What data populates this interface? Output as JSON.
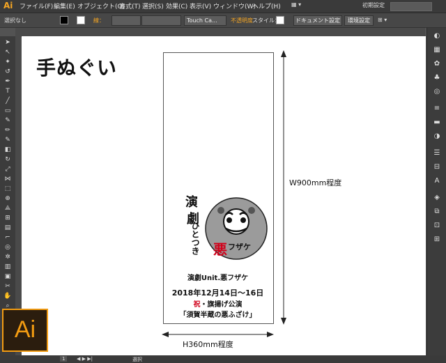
{
  "app": {
    "logo_small": "Ai",
    "logo_large": "Ai"
  },
  "menu": {
    "items": [
      "ファイル(F)",
      "編集(E)",
      "オブジェクト(O)",
      "書式(T)",
      "選択(S)",
      "効果(C)",
      "表示(V)",
      "ウィンドウ(W)",
      "ヘルプ(H)"
    ],
    "workspace": "初期設定"
  },
  "control": {
    "selection": "選択なし",
    "stroke_label": "線：",
    "touch_brush": "Touch Ca...",
    "opacity": "不透明度",
    "style": "スタイル：",
    "doc_settings": "ドキュメント設定",
    "env_settings": "環境設定"
  },
  "canvas": {
    "title": "手ぬぐい",
    "width_label": "W900mm程度",
    "height_label": "H360mm程度",
    "logo_text": "演劇Unit.悪フザケ",
    "dates": "2018年12月14日～16日",
    "celebration_prefix": "祝",
    "celebration_rest": "・旗揚げ公演",
    "show_title": "「須賀半蔵の悪ふざけ」",
    "stamp_text_red": "悪",
    "stamp_text_black": "フザケ",
    "side_text_1": "演",
    "side_text_2": "劇",
    "side_text_3": "ひとつき"
  },
  "status": {
    "zoom": "1",
    "tool": "選択"
  },
  "colors": {
    "accent": "#f39c12",
    "stamp_red": "#d0021b",
    "opacity_label": "#f5a623"
  }
}
